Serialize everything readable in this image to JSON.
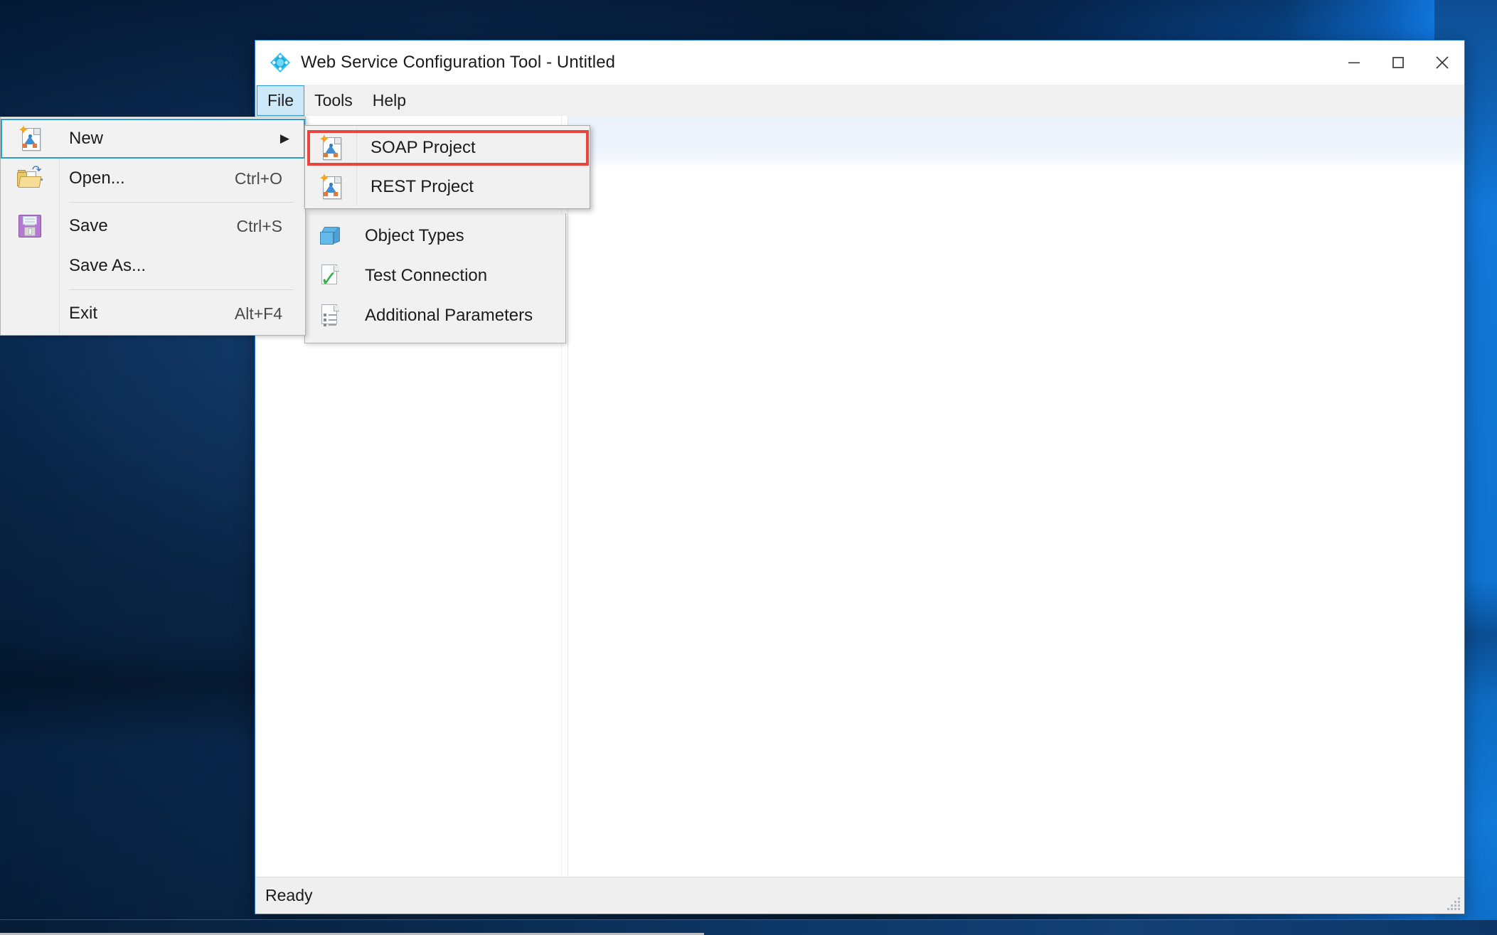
{
  "window": {
    "title": "Web Service Configuration Tool - Untitled",
    "app_icon": "app-diamond-icon",
    "controls": {
      "minimize": "Minimize",
      "maximize": "Maximize",
      "close": "Close"
    }
  },
  "menubar": {
    "items": [
      {
        "label": "File",
        "active": true
      },
      {
        "label": "Tools",
        "active": false
      },
      {
        "label": "Help",
        "active": false
      }
    ]
  },
  "file_menu": {
    "items": [
      {
        "label": "New",
        "accel": "",
        "icon": "new-document-icon",
        "submenu_arrow": "▶",
        "highlighted": true
      },
      {
        "label": "Open...",
        "accel": "Ctrl+O",
        "icon": "open-folder-icon",
        "submenu_arrow": "",
        "highlighted": false
      },
      {
        "label": "Save",
        "accel": "Ctrl+S",
        "icon": "save-floppy-icon",
        "submenu_arrow": "",
        "highlighted": false
      },
      {
        "label": "Save As...",
        "accel": "",
        "icon": "",
        "submenu_arrow": "",
        "highlighted": false
      },
      {
        "label": "Exit",
        "accel": "Alt+F4",
        "icon": "",
        "submenu_arrow": "",
        "highlighted": false
      }
    ]
  },
  "tools_menu_behind": {
    "items": [
      {
        "label": "Object Types",
        "icon": "blue-cube-icon"
      },
      {
        "label": "Test Connection",
        "icon": "green-check-document-icon"
      },
      {
        "label": "Additional Parameters",
        "icon": "parameters-document-icon"
      }
    ]
  },
  "new_submenu": {
    "items": [
      {
        "label": "SOAP Project",
        "icon": "new-document-icon",
        "highlighted": true
      },
      {
        "label": "REST Project",
        "icon": "new-document-icon",
        "highlighted": false
      }
    ]
  },
  "statusbar": {
    "text": "Ready",
    "resize_grip": "resize-grip-icon"
  },
  "colors": {
    "accent_blue": "#2e9bd6",
    "menu_highlight": "#cde8f9",
    "annotation_red": "#e8453c",
    "menu_background": "#f1f1f1",
    "statusbar_background": "#efefef",
    "content_band_blue": "#eef4fc",
    "desktop_blue": "#0d3362",
    "desktop_bright_blue": "#1177dd"
  }
}
